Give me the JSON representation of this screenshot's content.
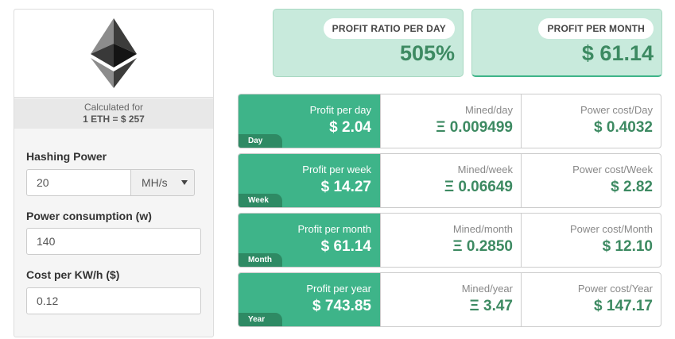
{
  "calc": {
    "line1": "Calculated for",
    "line2": "1 ETH = $ 257"
  },
  "form": {
    "hashing_label": "Hashing Power",
    "hashing_value": "20",
    "hashing_unit": "MH/s",
    "power_label": "Power consumption (w)",
    "power_value": "140",
    "cost_label": "Cost per KW/h ($)",
    "cost_value": "0.12"
  },
  "summary": {
    "ratio_label": "PROFIT RATIO PER DAY",
    "ratio_value": "505%",
    "month_label": "PROFIT PER MONTH",
    "month_value": "$ 61.14"
  },
  "rows": [
    {
      "tag": "Day",
      "profit_label": "Profit per day",
      "profit_value": "$ 2.04",
      "mined_label": "Mined/day",
      "mined_value": "Ξ 0.009499",
      "power_label": "Power cost/Day",
      "power_value": "$ 0.4032"
    },
    {
      "tag": "Week",
      "profit_label": "Profit per week",
      "profit_value": "$ 14.27",
      "mined_label": "Mined/week",
      "mined_value": "Ξ 0.06649",
      "power_label": "Power cost/Week",
      "power_value": "$ 2.82"
    },
    {
      "tag": "Month",
      "profit_label": "Profit per month",
      "profit_value": "$ 61.14",
      "mined_label": "Mined/month",
      "mined_value": "Ξ 0.2850",
      "power_label": "Power cost/Month",
      "power_value": "$ 12.10"
    },
    {
      "tag": "Year",
      "profit_label": "Profit per year",
      "profit_value": "$ 743.85",
      "mined_label": "Mined/year",
      "mined_value": "Ξ 3.47",
      "power_label": "Power cost/Year",
      "power_value": "$ 147.17"
    }
  ],
  "colors": {
    "accent": "#3eb489",
    "accent_dark": "#2e8a64",
    "value_text": "#3d8a62",
    "card_bg": "#c8eadc"
  },
  "icons": {
    "logo": "ethereum-logo-icon",
    "select": "chevron-down-icon"
  }
}
